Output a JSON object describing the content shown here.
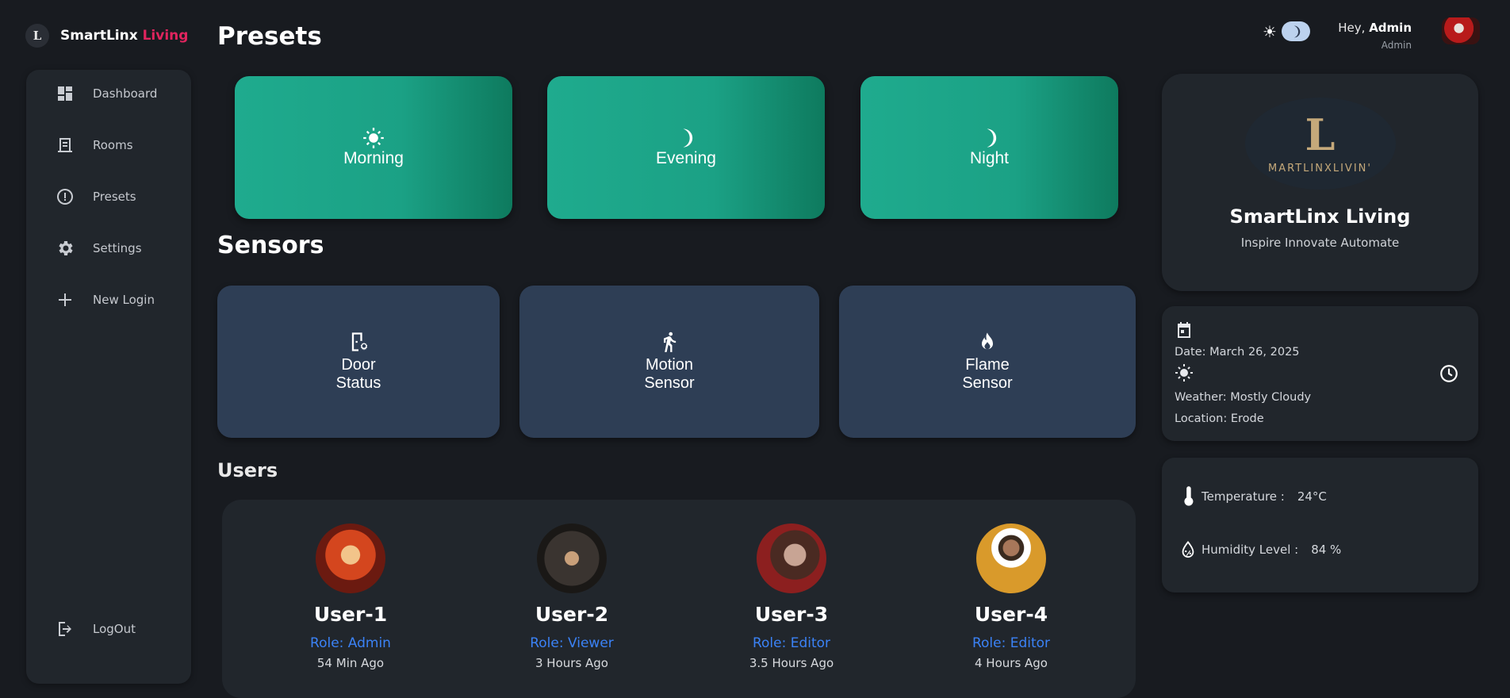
{
  "brand": {
    "logo_text": "L",
    "name_primary": "SmartLinx",
    "name_accent": "Living",
    "accent_color": "#e0245e"
  },
  "sidebar": {
    "items": [
      {
        "label": "Dashboard",
        "icon": "dashboard-icon"
      },
      {
        "label": "Rooms",
        "icon": "rooms-icon"
      },
      {
        "label": "Presets",
        "icon": "presets-icon"
      },
      {
        "label": "Settings",
        "icon": "gear-icon"
      },
      {
        "label": "New Login",
        "icon": "plus-icon"
      }
    ],
    "logout_label": "LogOut"
  },
  "headings": {
    "presets": "Presets",
    "sensors": "Sensors",
    "users": "Users"
  },
  "presets": [
    {
      "label": "Morning",
      "icon": "sun-gear-icon"
    },
    {
      "label": "Evening",
      "icon": "moon-icon"
    },
    {
      "label": "Night",
      "icon": "moon-icon"
    }
  ],
  "sensors": [
    {
      "line1": "Door",
      "line2": "Status",
      "icon": "door-settings-icon"
    },
    {
      "line1": "Motion",
      "line2": "Sensor",
      "icon": "running-person-icon"
    },
    {
      "line1": "Flame",
      "line2": "Sensor",
      "icon": "flame-icon"
    }
  ],
  "users": [
    {
      "name": "User-1",
      "role": "Role: Admin",
      "time": "54 Min Ago"
    },
    {
      "name": "User-2",
      "role": "Role: Viewer",
      "time": "3 Hours Ago"
    },
    {
      "name": "User-3",
      "role": "Role: Editor",
      "time": "3.5 Hours Ago"
    },
    {
      "name": "User-4",
      "role": "Role: Editor",
      "time": "4 Hours Ago"
    }
  ],
  "header": {
    "greeting_prefix": "Hey, ",
    "greeting_name": "Admin",
    "role": "Admin"
  },
  "brand_card": {
    "wordmark": "MARTLINXLIVIN'",
    "title": "SmartLinx Living",
    "tagline": "Inspire Innovate Automate"
  },
  "info": {
    "date": "Date: March 26, 2025",
    "weather": "Weather: Mostly Cloudy",
    "location": "Location: Erode"
  },
  "environment": {
    "temperature_label": "Temperature :",
    "temperature_value": "24°C",
    "humidity_label": "Humidity Level :",
    "humidity_value": "84 %"
  },
  "colors": {
    "background": "#181b20",
    "panel": "#21262c",
    "preset_green": "#1ba185",
    "sensor_blue": "#2e3e55",
    "role_blue": "#3b82f6"
  }
}
